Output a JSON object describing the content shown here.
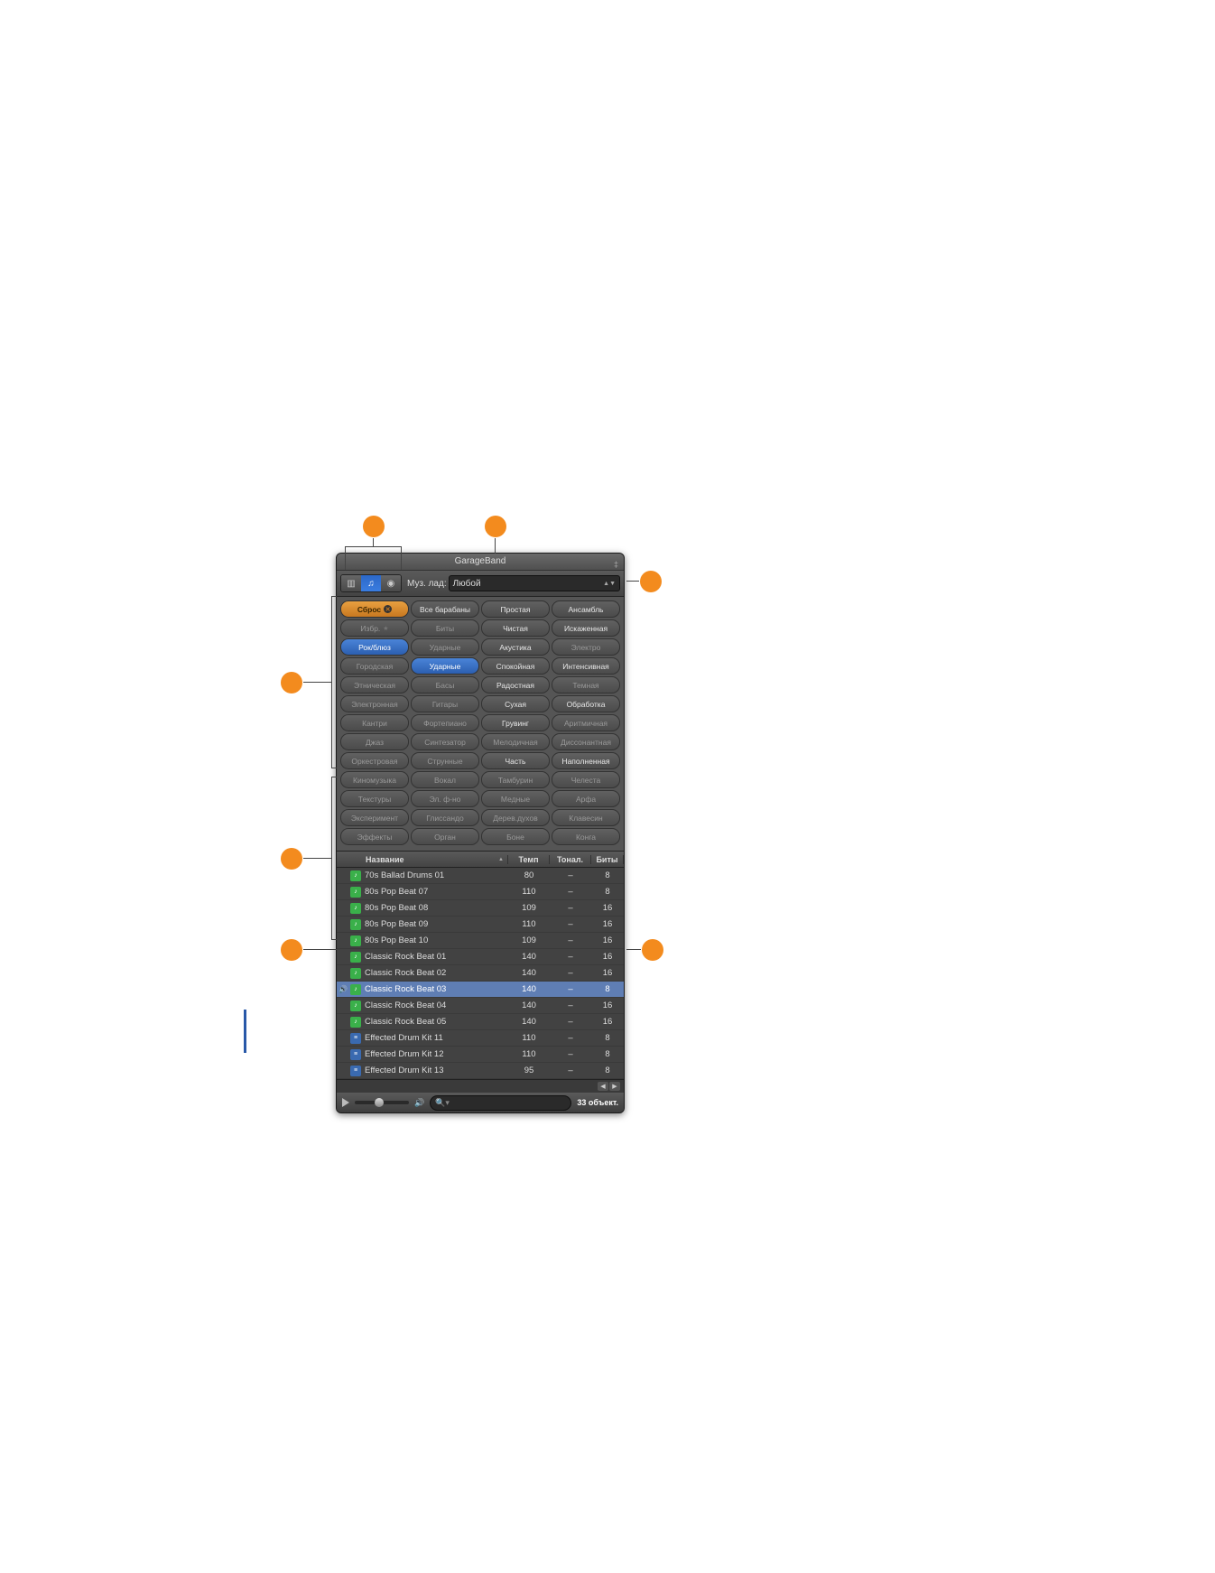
{
  "panel": {
    "title": "GarageBand",
    "scale_label": "Муз. лад:",
    "scale_value": "Любой",
    "footer_count": "33 объект."
  },
  "tags": [
    [
      {
        "label": "Сброс",
        "style": "sel-orange",
        "x": true
      },
      {
        "label": "Все барабаны",
        "style": "enabled"
      },
      {
        "label": "Простая",
        "style": "enabled"
      },
      {
        "label": "Ансамбль",
        "style": "enabled"
      }
    ],
    [
      {
        "label": "Избр.",
        "style": "",
        "star": true
      },
      {
        "label": "Биты",
        "style": ""
      },
      {
        "label": "Чистая",
        "style": "enabled"
      },
      {
        "label": "Искаженная",
        "style": "enabled"
      }
    ],
    [
      {
        "label": "Рок/блюз",
        "style": "sel-blue"
      },
      {
        "label": "Ударные",
        "style": ""
      },
      {
        "label": "Акустика",
        "style": "enabled"
      },
      {
        "label": "Электро",
        "style": ""
      }
    ],
    [
      {
        "label": "Городская",
        "style": ""
      },
      {
        "label": "Ударные",
        "style": "sel-blue"
      },
      {
        "label": "Спокойная",
        "style": "enabled"
      },
      {
        "label": "Интенсивная",
        "style": "enabled"
      }
    ],
    [
      {
        "label": "Этническая",
        "style": ""
      },
      {
        "label": "Басы",
        "style": ""
      },
      {
        "label": "Радостная",
        "style": "enabled"
      },
      {
        "label": "Темная",
        "style": ""
      }
    ],
    [
      {
        "label": "Электронная",
        "style": ""
      },
      {
        "label": "Гитары",
        "style": ""
      },
      {
        "label": "Сухая",
        "style": "enabled"
      },
      {
        "label": "Обработка",
        "style": "enabled"
      }
    ],
    [
      {
        "label": "Кантри",
        "style": ""
      },
      {
        "label": "Фортепиано",
        "style": ""
      },
      {
        "label": "Грувинг",
        "style": "enabled"
      },
      {
        "label": "Аритмичная",
        "style": ""
      }
    ],
    [
      {
        "label": "Джаз",
        "style": ""
      },
      {
        "label": "Синтезатор",
        "style": ""
      },
      {
        "label": "Мелодичная",
        "style": ""
      },
      {
        "label": "Диссонантная",
        "style": ""
      }
    ],
    [
      {
        "label": "Оркестровая",
        "style": ""
      },
      {
        "label": "Струнные",
        "style": ""
      },
      {
        "label": "Часть",
        "style": "enabled"
      },
      {
        "label": "Наполненная",
        "style": "enabled"
      }
    ],
    [
      {
        "label": "Киномузыка",
        "style": ""
      },
      {
        "label": "Вокал",
        "style": ""
      },
      {
        "label": "Тамбурин",
        "style": ""
      },
      {
        "label": "Челеста",
        "style": ""
      }
    ],
    [
      {
        "label": "Текстуры",
        "style": ""
      },
      {
        "label": "Эл. ф-но",
        "style": ""
      },
      {
        "label": "Медные",
        "style": ""
      },
      {
        "label": "Арфа",
        "style": ""
      }
    ],
    [
      {
        "label": "Эксперимент",
        "style": ""
      },
      {
        "label": "Глиссандо",
        "style": ""
      },
      {
        "label": "Дерев.духов",
        "style": ""
      },
      {
        "label": "Клавесин",
        "style": ""
      }
    ],
    [
      {
        "label": "Эффекты",
        "style": ""
      },
      {
        "label": "Орган",
        "style": ""
      },
      {
        "label": "Боне",
        "style": ""
      },
      {
        "label": "Конга",
        "style": ""
      }
    ]
  ],
  "columns": {
    "name": "Название",
    "temp": "Темп",
    "ton": "Тонал.",
    "bit": "Биты"
  },
  "rows": [
    {
      "ico": "green",
      "name": "70s Ballad Drums 01",
      "temp": "80",
      "ton": "–",
      "bit": "8",
      "sel": false
    },
    {
      "ico": "green",
      "name": "80s Pop Beat 07",
      "temp": "110",
      "ton": "–",
      "bit": "8",
      "sel": false
    },
    {
      "ico": "green",
      "name": "80s Pop Beat 08",
      "temp": "109",
      "ton": "–",
      "bit": "16",
      "sel": false
    },
    {
      "ico": "green",
      "name": "80s Pop Beat 09",
      "temp": "110",
      "ton": "–",
      "bit": "16",
      "sel": false
    },
    {
      "ico": "green",
      "name": "80s Pop Beat 10",
      "temp": "109",
      "ton": "–",
      "bit": "16",
      "sel": false
    },
    {
      "ico": "green",
      "name": "Classic Rock Beat 01",
      "temp": "140",
      "ton": "–",
      "bit": "16",
      "sel": false
    },
    {
      "ico": "green",
      "name": "Classic Rock Beat 02",
      "temp": "140",
      "ton": "–",
      "bit": "16",
      "sel": false
    },
    {
      "ico": "green",
      "name": "Classic Rock Beat 03",
      "temp": "140",
      "ton": "–",
      "bit": "8",
      "sel": true
    },
    {
      "ico": "green",
      "name": "Classic Rock Beat 04",
      "temp": "140",
      "ton": "–",
      "bit": "16",
      "sel": false
    },
    {
      "ico": "green",
      "name": "Classic Rock Beat 05",
      "temp": "140",
      "ton": "–",
      "bit": "16",
      "sel": false
    },
    {
      "ico": "blue",
      "name": "Effected Drum Kit 11",
      "temp": "110",
      "ton": "–",
      "bit": "8",
      "sel": false
    },
    {
      "ico": "blue",
      "name": "Effected Drum Kit 12",
      "temp": "110",
      "ton": "–",
      "bit": "8",
      "sel": false
    },
    {
      "ico": "blue",
      "name": "Effected Drum Kit 13",
      "temp": "95",
      "ton": "–",
      "bit": "8",
      "sel": false
    }
  ]
}
